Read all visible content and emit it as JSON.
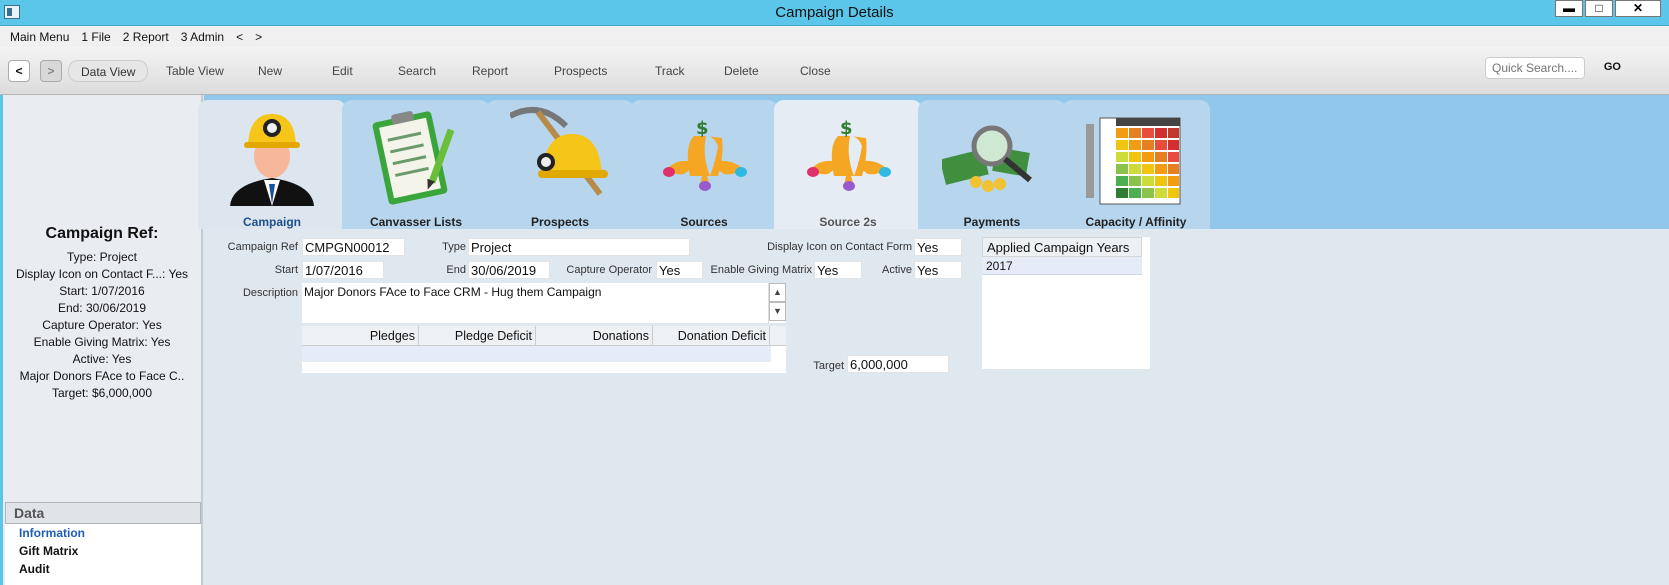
{
  "window": {
    "title": "Campaign Details",
    "min": "▬",
    "max": "□",
    "close": "✕"
  },
  "menu": [
    "Main Menu",
    "1 File",
    "2 Report",
    "3 Admin",
    "<",
    ">"
  ],
  "toolbar": {
    "back": "<",
    "forward": ">",
    "buttons": [
      "Data View",
      "Table View",
      "New",
      "Edit",
      "Search",
      "Report",
      "Prospects",
      "Track",
      "Delete",
      "Close"
    ],
    "search_placeholder": "Quick Search....",
    "go": "GO"
  },
  "summary": {
    "heading": "Campaign Ref:",
    "lines": [
      "Type: Project",
      "Display Icon on Contact F...: Yes",
      "Start: 1/07/2016",
      "End: 30/06/2019",
      "Capture Operator: Yes",
      "Enable Giving Matrix: Yes",
      "Active: Yes",
      "Major Donors FAce to Face C..",
      "Target: $6,000,000"
    ]
  },
  "data_panel": {
    "header": "Data",
    "links": [
      "Information",
      "Gift Matrix",
      "Audit"
    ]
  },
  "tabs": [
    {
      "label": "Campaign",
      "icon": "miner-person-icon"
    },
    {
      "label": "Canvasser Lists",
      "icon": "clipboard-icon"
    },
    {
      "label": "Prospects",
      "icon": "pickaxe-helmet-icon"
    },
    {
      "label": "Sources",
      "icon": "sources-icon"
    },
    {
      "label": "Source 2s",
      "icon": "sources-icon"
    },
    {
      "label": "Payments",
      "icon": "money-magnifier-icon"
    },
    {
      "label": "Capacity / Affinity",
      "icon": "matrix-chart-icon"
    }
  ],
  "form": {
    "campaign_ref_label": "Campaign Ref",
    "campaign_ref": "CMPGN00012",
    "type_label": "Type",
    "type": "Project",
    "display_icon_label": "Display Icon on Contact Form",
    "display_icon": "Yes",
    "start_label": "Start",
    "start": "1/07/2016",
    "end_label": "End",
    "end": "30/06/2019",
    "capture_label": "Capture Operator",
    "capture": "Yes",
    "giving_label": "Enable Giving Matrix",
    "giving": "Yes",
    "active_label": "Active",
    "active": "Yes",
    "description_label": "Description",
    "description": "Major Donors FAce to Face CRM - Hug them Campaign",
    "target_label": "Target",
    "target": "6,000,000"
  },
  "pledge_grid": {
    "columns": [
      "Pledges",
      "Pledge Deficit",
      "Donations",
      "Donation Deficit"
    ]
  },
  "years": {
    "header": "Applied Campaign Years",
    "rows": [
      "2017"
    ]
  }
}
